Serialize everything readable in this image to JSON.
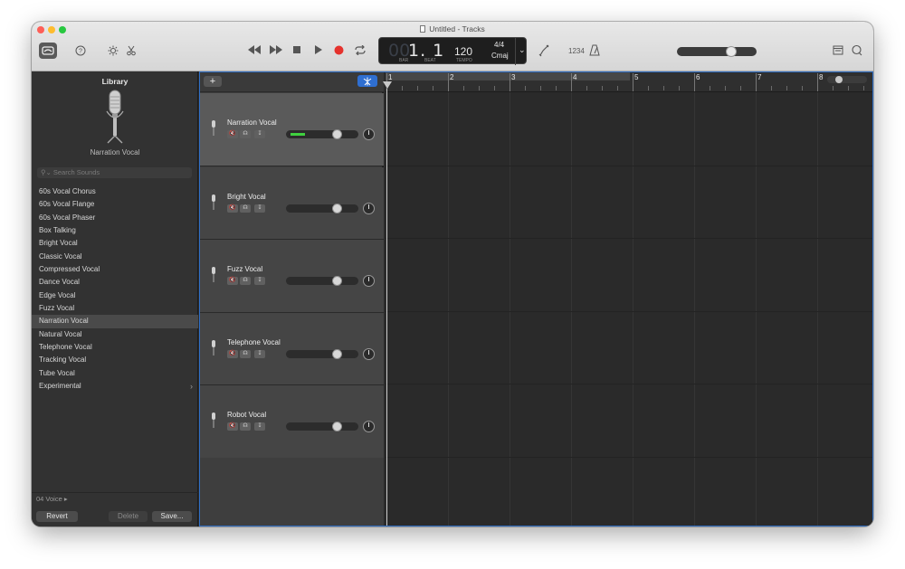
{
  "window": {
    "title": "Untitled - Tracks"
  },
  "toolbar": {
    "lcd": {
      "bar_dim": "00",
      "position": "1. 1",
      "bar_label": "BAR",
      "beat_label": "BEAT",
      "tempo": "120",
      "tempo_label": "TEMPO",
      "time_signature": "4/4",
      "key": "Cmaj"
    },
    "count_in_label": "1234",
    "master_volume": 0.7
  },
  "library": {
    "title": "Library",
    "selected_patch": "Narration Vocal",
    "search_placeholder": "Search Sounds",
    "items": [
      "60s Vocal Chorus",
      "60s Vocal Flange",
      "60s Vocal Phaser",
      "Box Talking",
      "Bright Vocal",
      "Classic Vocal",
      "Compressed Vocal",
      "Dance Vocal",
      "Edge Vocal",
      "Fuzz Vocal",
      "Narration Vocal",
      "Natural Vocal",
      "Telephone Vocal",
      "Tracking Vocal",
      "Tube Vocal",
      "Experimental"
    ],
    "footer": {
      "category": "04 Voice",
      "revert": "Revert",
      "delete": "Delete",
      "save": "Save..."
    }
  },
  "tracks": [
    {
      "name": "Narration Vocal",
      "selected": true
    },
    {
      "name": "Bright Vocal",
      "selected": false
    },
    {
      "name": "Fuzz Vocal",
      "selected": false
    },
    {
      "name": "Telephone Vocal",
      "selected": false
    },
    {
      "name": "Robot Vocal",
      "selected": false
    }
  ],
  "ruler": {
    "bars": [
      "1",
      "2",
      "3",
      "4",
      "5",
      "6",
      "7",
      "8"
    ]
  },
  "colors": {
    "accent": "#2f6fd1",
    "record": "#e5322d",
    "level": "#3fd13f"
  }
}
